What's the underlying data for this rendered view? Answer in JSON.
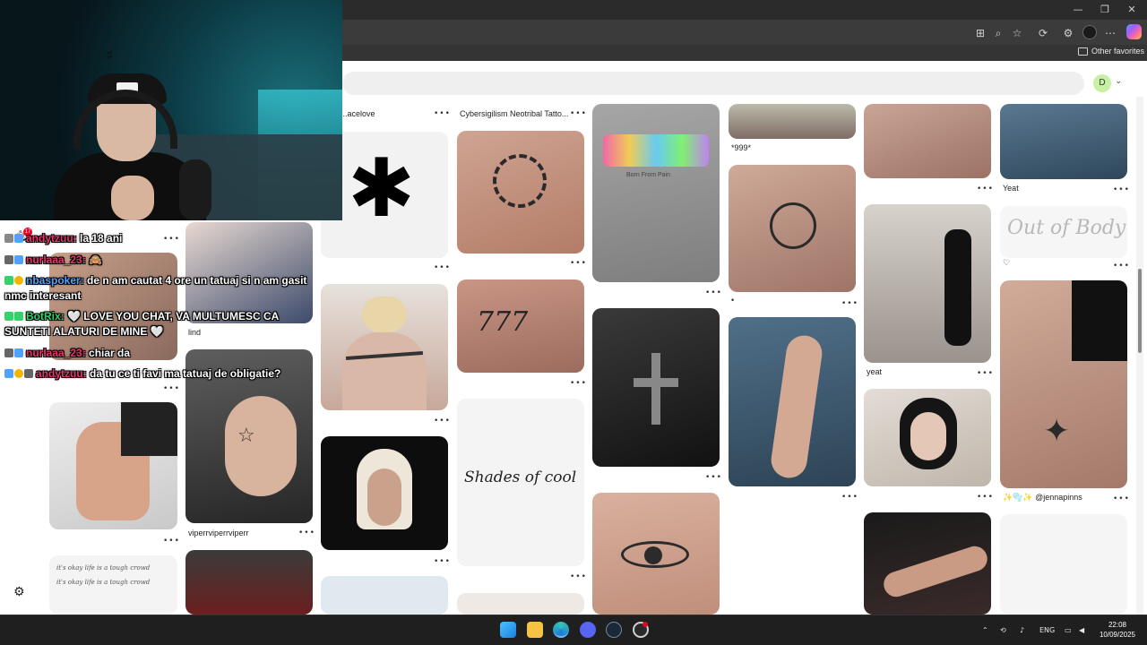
{
  "browser": {
    "favorites_label": "Other favorites",
    "avatar_letter": "D"
  },
  "chat": {
    "notification_count": "17",
    "messages": [
      {
        "user": "andytzuu:",
        "text": " la 18 ani"
      },
      {
        "user": "nurlaaa_23:",
        "text": " 🙈"
      },
      {
        "user": "nbaspoker:",
        "text": " de n am cautat 4 ore un tatuaj si n am gasit"
      },
      {
        "user": "",
        "text": "nmc interesant"
      },
      {
        "user": "BotRix:",
        "text": " 🤍 LOVE YOU CHAT, VA MULTUMESC CA"
      },
      {
        "user": "",
        "text": "SUNTETI ALATURI DE MINE 🤍"
      },
      {
        "user": "nurlaaa_23:",
        "text": " chiar da"
      },
      {
        "user": "andytzuu:",
        "text": " da tu ce ti favi ma tatuaj de obligatie?"
      }
    ]
  },
  "pins": {
    "captions": {
      "c2_top": "...acelove",
      "c3_top": "Cybersigilism Neotribal Tatto...",
      "c5_999": "*999*",
      "c5_dot": "•",
      "c7_yeat": "Yeat",
      "c6_yeat": "yeat",
      "c7_heart": "♡",
      "c1_lind": "lind",
      "c1_viper": "viperrviperrviperr",
      "c7_jenna": "✨🫧✨ @jennapinns"
    },
    "art_text": {
      "out_of_body": "Out of Body",
      "shades_of_cool": "Shades of cool",
      "born_from_pain": "Born From Pain",
      "sevens": "777",
      "asterisk": "✱",
      "chat_bg_line1": "it's okay life is a tough crowd",
      "chat_bg_line2": "it's okay life is a tough crowd"
    }
  },
  "taskbar": {
    "language": "ENG",
    "time": "22:08",
    "date": "10/09/2025"
  },
  "colors": {
    "accent_red": "#e60023",
    "chat_user_red": "#e6356b",
    "chat_user_blue": "#4fa3ff",
    "chat_user_green": "#35d26a"
  }
}
